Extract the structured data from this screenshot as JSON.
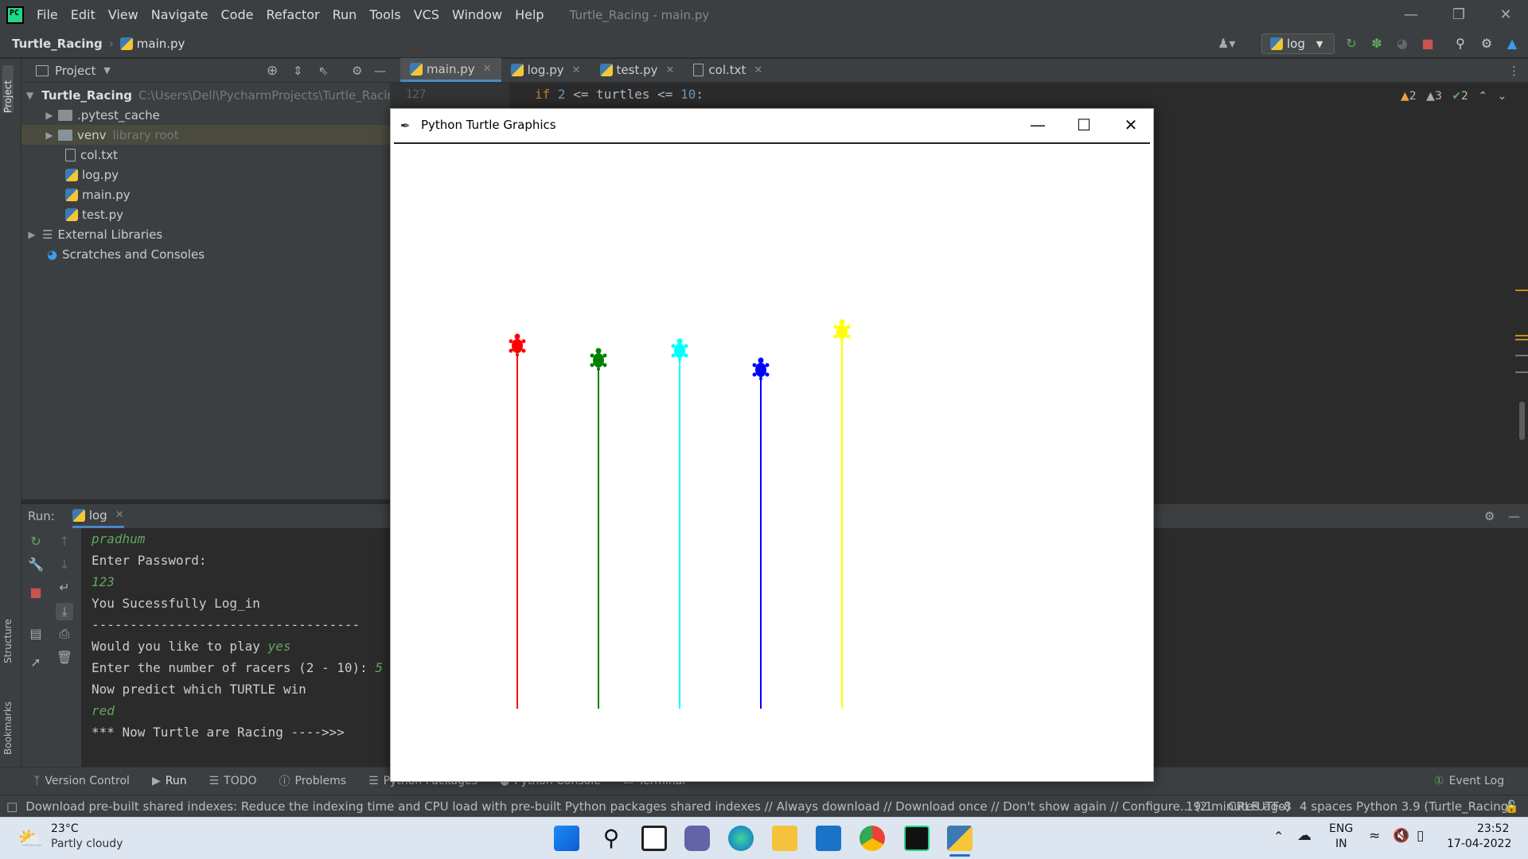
{
  "titlebar": {
    "menu": [
      "File",
      "Edit",
      "View",
      "Navigate",
      "Code",
      "Refactor",
      "Run",
      "Tools",
      "VCS",
      "Window",
      "Help"
    ],
    "window_title": "Turtle_Racing - main.py"
  },
  "navbar": {
    "project": "Turtle_Racing",
    "file": "main.py",
    "run_config": "log"
  },
  "project_panel": {
    "title": "Project",
    "items": [
      {
        "label": "Turtle_Racing",
        "extra": "C:\\Users\\Dell\\PycharmProjects\\Turtle_Racing"
      },
      {
        "label": ".pytest_cache",
        "extra": ""
      },
      {
        "label": "venv",
        "extra": "library root"
      },
      {
        "label": "col.txt",
        "extra": ""
      },
      {
        "label": "log.py",
        "extra": ""
      },
      {
        "label": "main.py",
        "extra": ""
      },
      {
        "label": "test.py",
        "extra": ""
      },
      {
        "label": "External Libraries",
        "extra": ""
      },
      {
        "label": "Scratches and Consoles",
        "extra": ""
      }
    ]
  },
  "editor": {
    "tabs": [
      "main.py",
      "log.py",
      "test.py",
      "col.txt"
    ],
    "line_number": "127",
    "code_kw": "if",
    "code_num1": "2",
    "code_mid": "<= turtles <=",
    "code_num2": "10",
    "code_end": ":",
    "warnings": "2",
    "weak_warnings": "3",
    "ok_count": "2"
  },
  "run_panel": {
    "label": "Run:",
    "tab": "log",
    "lines": [
      {
        "text": "pradhum",
        "kind": "inp"
      },
      {
        "text": "Enter Password:",
        "kind": "out"
      },
      {
        "text": "123",
        "kind": "inp"
      },
      {
        "text": "You Sucessfully Log_in",
        "kind": "out"
      },
      {
        "text": "-----------------------------------",
        "kind": "out"
      },
      {
        "text": "Would you like to play ",
        "kind": "out",
        "input": "yes"
      },
      {
        "text": "Enter the number of racers (2 - 10): ",
        "kind": "out",
        "input": "5"
      },
      {
        "text": "Now predict which TURTLE win",
        "kind": "out"
      },
      {
        "text": "red",
        "kind": "inp"
      },
      {
        "text": "*** Now Turtle are Racing ---->>>",
        "kind": "out"
      }
    ]
  },
  "tool_windows": [
    "Version Control",
    "Run",
    "TODO",
    "Problems",
    "Python Packages",
    "Python Console",
    "Terminal"
  ],
  "event_log": "Event Log",
  "status": {
    "message": "Download pre-built shared indexes: Reduce the indexing time and CPU load with pre-built Python packages shared indexes // Always download // Download once // Don't show again // Configure... (2 minutes ago)",
    "position": "19:1",
    "line_sep": "CRLF",
    "encoding": "UTF-8",
    "indent": "4 spaces",
    "interpreter": "Python 3.9 (Turtle_Racing)"
  },
  "turtle_window": {
    "title": "Python Turtle Graphics",
    "turtles": [
      {
        "color": "#ff0000",
        "progress": 0.76
      },
      {
        "color": "#008000",
        "progress": 0.73
      },
      {
        "color": "#00ffff",
        "progress": 0.75
      },
      {
        "color": "#0000ff",
        "progress": 0.71
      },
      {
        "color": "#ffff00",
        "progress": 0.79
      }
    ]
  },
  "taskbar": {
    "temperature": "23°C",
    "weather": "Partly cloudy",
    "lang1": "ENG",
    "lang2": "IN",
    "time": "23:52",
    "date": "17-04-2022"
  },
  "colors": {
    "accent": "#4a88c7",
    "ide_bg": "#2b2b2b",
    "panel_bg": "#3c3f41"
  }
}
